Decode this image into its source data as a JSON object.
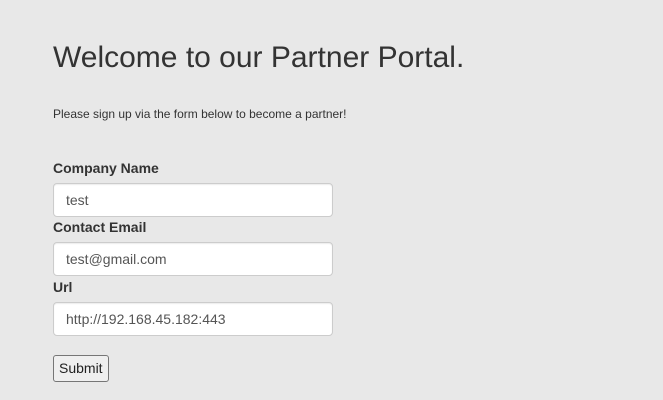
{
  "page": {
    "title": "Welcome to our Partner Portal.",
    "intro": "Please sign up via the form below to become a partner!"
  },
  "form": {
    "company": {
      "label": "Company Name",
      "value": "test"
    },
    "email": {
      "label": "Contact Email",
      "value": "test@gmail.com"
    },
    "url": {
      "label": "Url",
      "value": "http://192.168.45.182:443"
    },
    "submit_label": "Submit"
  },
  "colors": {
    "background": "#e8e8e8",
    "text": "#333333",
    "input_border": "#cccccc"
  }
}
